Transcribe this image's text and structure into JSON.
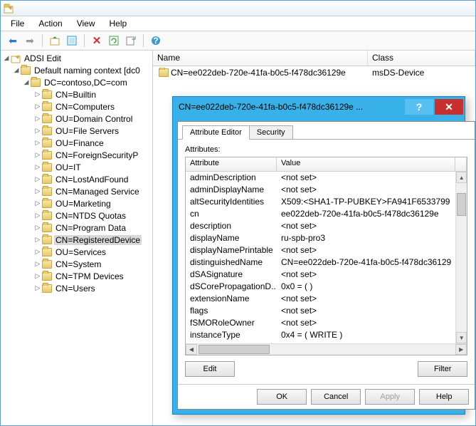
{
  "menu": {
    "file": "File",
    "action": "Action",
    "view": "View",
    "help": "Help"
  },
  "tree": {
    "root": "ADSI Edit",
    "ctx": "Default naming context [dc0",
    "dc": "DC=contoso,DC=com",
    "children": [
      "CN=Builtin",
      "CN=Computers",
      "OU=Domain Control",
      "OU=File Servers",
      "OU=Finance",
      "CN=ForeignSecurityP",
      "OU=IT",
      "CN=LostAndFound",
      "CN=Managed Service",
      "OU=Marketing",
      "CN=NTDS Quotas",
      "CN=Program Data",
      "CN=RegisteredDevice",
      "OU=Services",
      "CN=System",
      "CN=TPM Devices",
      "CN=Users"
    ],
    "selectedIndex": 12
  },
  "list": {
    "cols": {
      "name": "Name",
      "class": "Class"
    },
    "row": {
      "name": "CN=ee022deb-720e-41fa-b0c5-f478dc36129e",
      "class": "msDS-Device"
    }
  },
  "dialog": {
    "title": "CN=ee022deb-720e-41fa-b0c5-f478dc36129e ...",
    "tabs": {
      "editor": "Attribute Editor",
      "security": "Security"
    },
    "attrLabel": "Attributes:",
    "gridCols": {
      "attr": "Attribute",
      "val": "Value"
    },
    "rows": [
      {
        "a": "adminDescription",
        "v": "<not set>"
      },
      {
        "a": "adminDisplayName",
        "v": "<not set>"
      },
      {
        "a": "altSecurityIdentities",
        "v": "X509:<SHA1-TP-PUBKEY>FA941F6533799"
      },
      {
        "a": "cn",
        "v": "ee022deb-720e-41fa-b0c5-f478dc36129e"
      },
      {
        "a": "description",
        "v": "<not set>"
      },
      {
        "a": "displayName",
        "v": "ru-spb-pro3"
      },
      {
        "a": "displayNamePrintable",
        "v": "<not set>"
      },
      {
        "a": "distinguishedName",
        "v": "CN=ee022deb-720e-41fa-b0c5-f478dc36129"
      },
      {
        "a": "dSASignature",
        "v": "<not set>"
      },
      {
        "a": "dSCorePropagationD...",
        "v": "0x0 = (  )"
      },
      {
        "a": "extensionName",
        "v": "<not set>"
      },
      {
        "a": "flags",
        "v": "<not set>"
      },
      {
        "a": "fSMORoleOwner",
        "v": "<not set>"
      },
      {
        "a": "instanceType",
        "v": "0x4 = ( WRITE )"
      }
    ],
    "buttons": {
      "edit": "Edit",
      "filter": "Filter",
      "ok": "OK",
      "cancel": "Cancel",
      "apply": "Apply",
      "help": "Help"
    }
  }
}
